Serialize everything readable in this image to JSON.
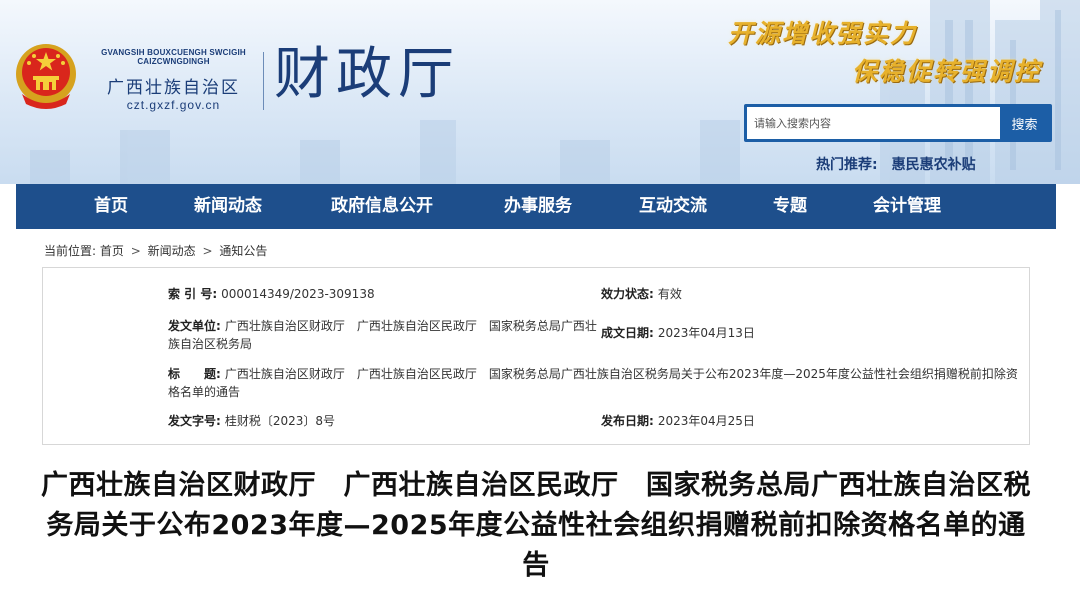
{
  "header": {
    "site_roman": "GVANGSIH BOUXCUENGH SWCIGIH CAIZCWNGDINGH",
    "region_name": "广西壮族自治区",
    "domain": "czt.gxzf.gov.cn",
    "department": "财政厅",
    "slogan_1": "开源增收强实力",
    "slogan_2": "保稳促转强调控",
    "emblem_icon": "national-emblem-icon"
  },
  "search": {
    "placeholder": "请输入搜索内容",
    "button_label": "搜索"
  },
  "hot": {
    "label": "热门推荐:",
    "link": "惠民惠农补贴"
  },
  "nav": {
    "items": [
      {
        "label": "首页"
      },
      {
        "label": "新闻动态"
      },
      {
        "label": "政府信息公开"
      },
      {
        "label": "办事服务"
      },
      {
        "label": "互动交流"
      },
      {
        "label": "专题"
      },
      {
        "label": "会计管理"
      }
    ]
  },
  "breadcrumb": {
    "prefix": "当前位置:",
    "items": [
      "首页",
      "新闻动态",
      "通知公告"
    ],
    "separator": ">"
  },
  "info": {
    "index_label": "索 引 号:",
    "index_value": "000014349/2023-309138",
    "status_label": "效力状态:",
    "status_value": "有效",
    "issuer_label": "发文单位:",
    "issuer_value": "广西壮族自治区财政厅　广西壮族自治区民政厅　国家税务总局广西壮族自治区税务局",
    "created_label": "成文日期:",
    "created_value": "2023年04月13日",
    "title_label": "标　　题:",
    "title_value": "广西壮族自治区财政厅　广西壮族自治区民政厅　国家税务总局广西壮族自治区税务局关于公布2023年度—2025年度公益性社会组织捐赠税前扣除资格名单的通告",
    "docno_label": "发文字号:",
    "docno_value": "桂财税〔2023〕8号",
    "published_label": "发布日期:",
    "published_value": "2023年04月25日"
  },
  "article": {
    "title": "广西壮族自治区财政厅　广西壮族自治区民政厅　国家税务总局广西壮族自治区税务局关于公布2023年度—2025年度公益性社会组织捐赠税前扣除资格名单的通告"
  },
  "colors": {
    "nav_bg": "#1e4f8c",
    "brand_blue": "#1b3d78",
    "search_blue": "#1c5ea6",
    "slogan_gold": "#e7b12c"
  }
}
